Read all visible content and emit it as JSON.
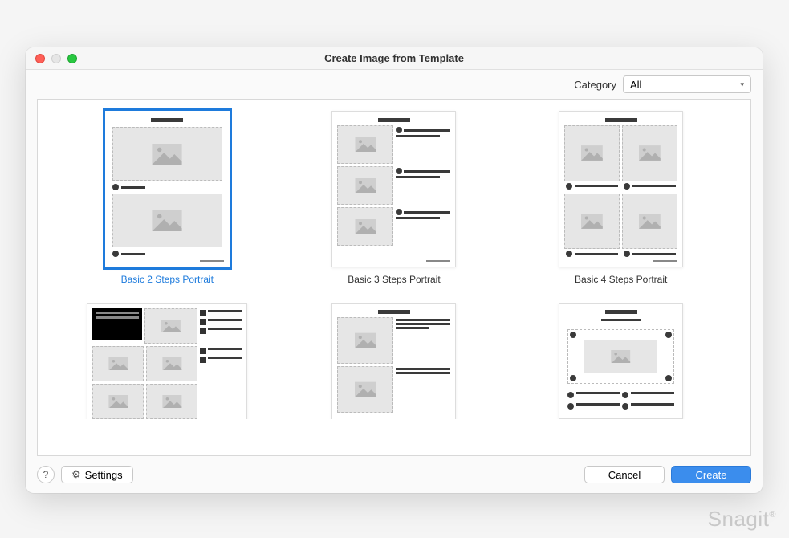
{
  "window": {
    "title": "Create Image from Template"
  },
  "toolbar": {
    "category_label": "Category",
    "category_value": "All"
  },
  "templates": [
    {
      "label": "Basic 2 Steps Portrait",
      "selected": true
    },
    {
      "label": "Basic 3 Steps Portrait",
      "selected": false
    },
    {
      "label": "Basic 4 Steps Portrait",
      "selected": false
    },
    {
      "label": "",
      "selected": false
    },
    {
      "label": "",
      "selected": false
    },
    {
      "label": "",
      "selected": false
    }
  ],
  "footer": {
    "settings_label": "Settings",
    "cancel_label": "Cancel",
    "create_label": "Create"
  },
  "watermark": "Snagit"
}
